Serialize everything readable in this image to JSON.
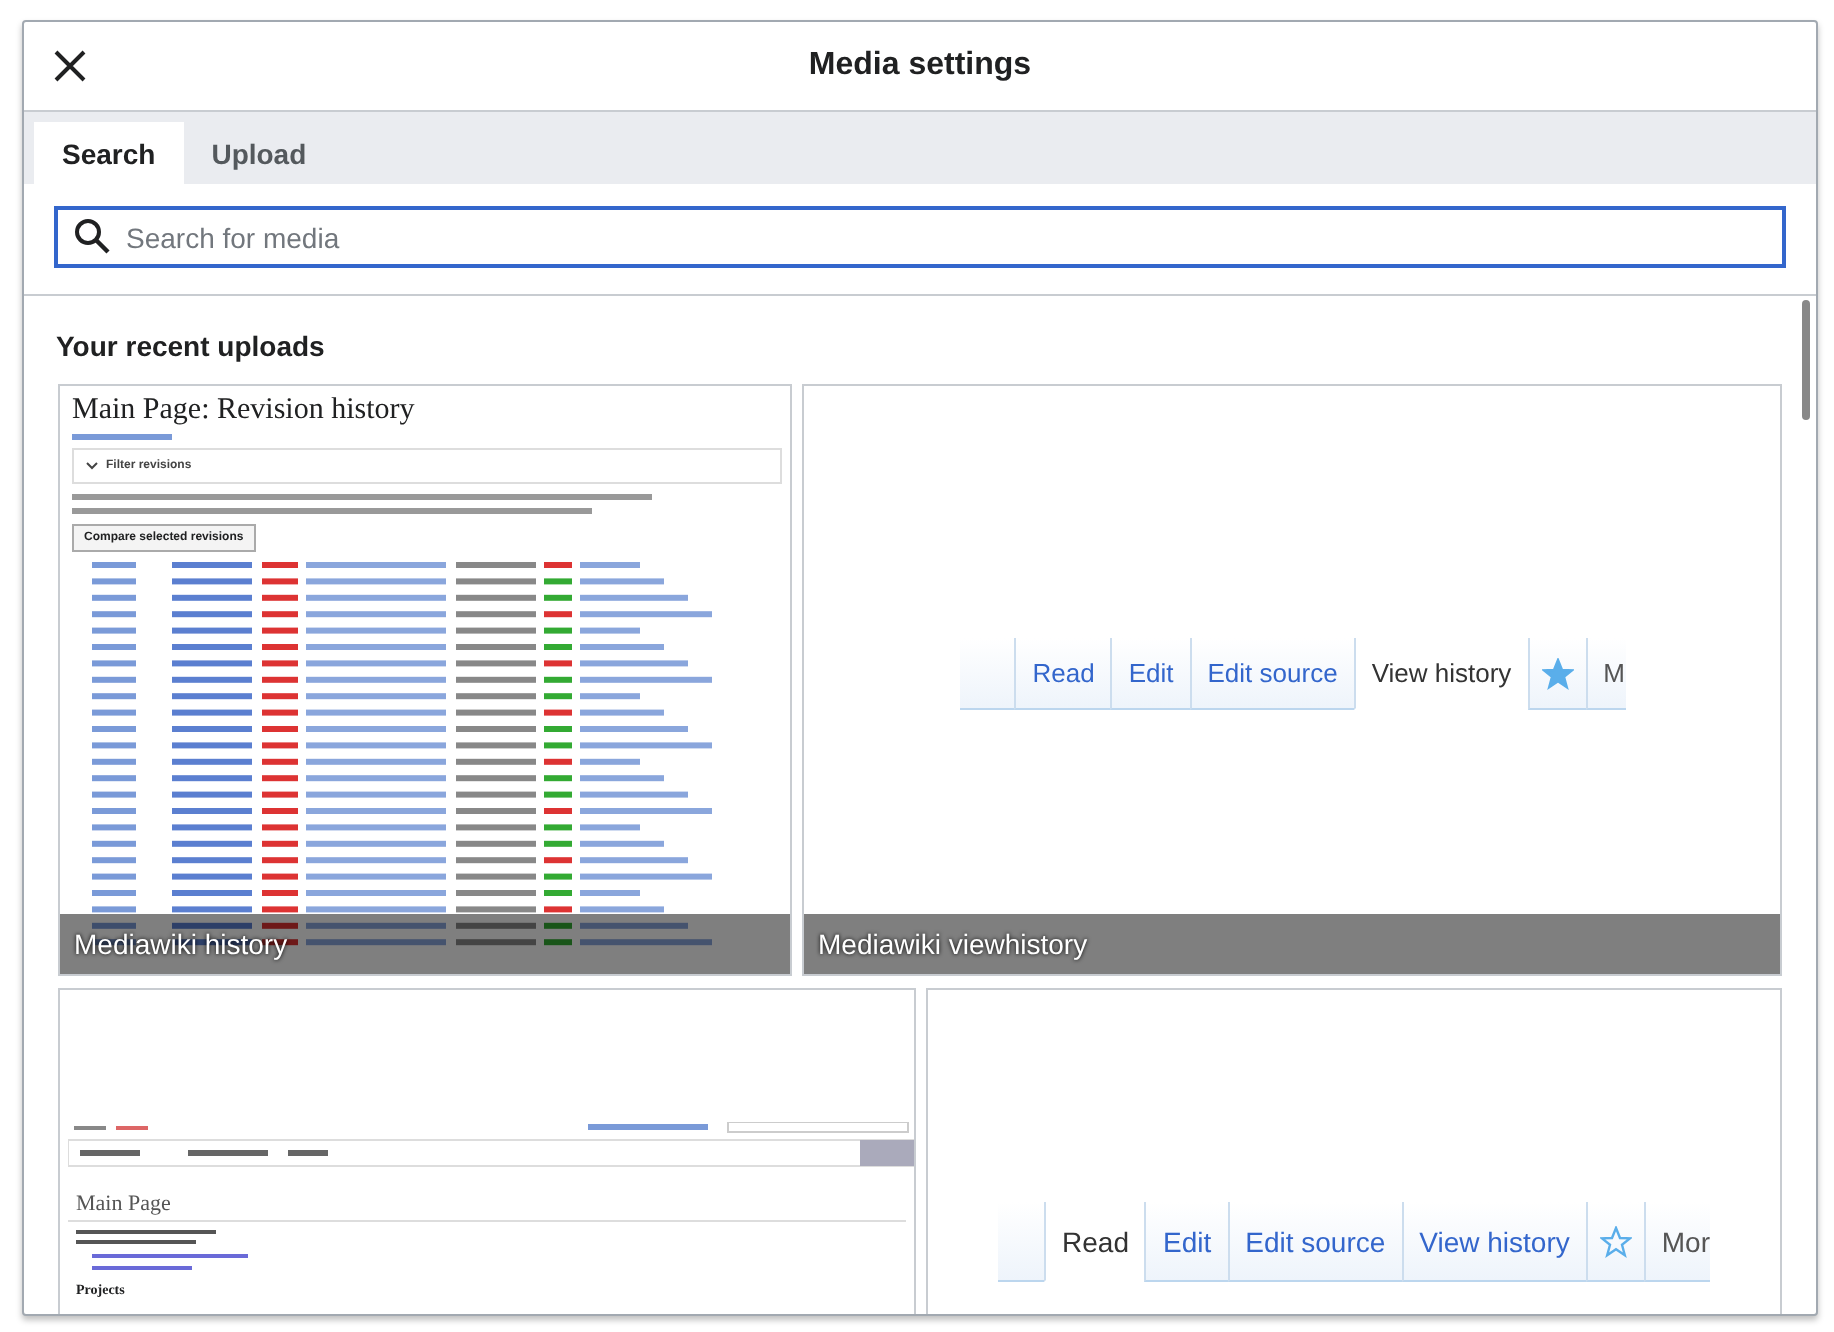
{
  "dialog": {
    "title": "Media settings"
  },
  "tabs": [
    {
      "label": "Search",
      "selected": true
    },
    {
      "label": "Upload",
      "selected": false
    }
  ],
  "search": {
    "placeholder": "Search for media"
  },
  "section_title": "Your recent uploads",
  "uploads": [
    {
      "kind": "history",
      "caption": "Mediawiki history",
      "page_title": "Main Page: Revision history",
      "filter_label": "Filter revisions",
      "compare_button": "Compare selected revisions"
    },
    {
      "kind": "tabs",
      "caption": "Mediawiki viewhistory",
      "watched": true,
      "tabs": [
        {
          "label": "Read",
          "selected": false
        },
        {
          "label": "Edit",
          "selected": false
        },
        {
          "label": "Edit source",
          "selected": false
        },
        {
          "label": "View history",
          "selected": true
        },
        {
          "label": "M",
          "selected": false
        }
      ]
    },
    {
      "kind": "editor",
      "page_title": "Main Page",
      "heading": "Projects"
    },
    {
      "kind": "tabs",
      "watched": false,
      "tabs": [
        {
          "label": "Read",
          "selected": true
        },
        {
          "label": "Edit",
          "selected": false
        },
        {
          "label": "Edit source",
          "selected": false
        },
        {
          "label": "View history",
          "selected": false
        },
        {
          "label": "Mor",
          "selected": false
        }
      ]
    }
  ]
}
